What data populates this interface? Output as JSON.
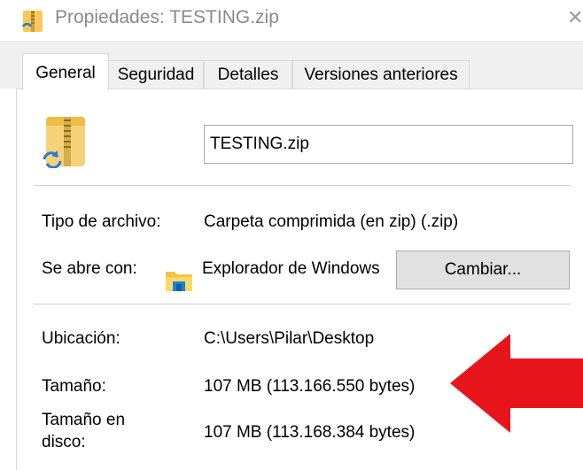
{
  "window": {
    "title": "Propiedades: TESTING.zip",
    "close_glyph": "✕",
    "icon": "zip-folder-icon"
  },
  "tabs": [
    {
      "label": "General",
      "active": true
    },
    {
      "label": "Seguridad",
      "active": false
    },
    {
      "label": "Detalles",
      "active": false
    },
    {
      "label": "Versiones anteriores",
      "active": false
    }
  ],
  "general": {
    "file_name": "TESTING.zip",
    "file_type_label": "Tipo de archivo:",
    "file_type_value": "Carpeta comprimida (en zip) (.zip)",
    "opens_with_label": "Se abre con:",
    "opens_with_value": "Explorador de Windows",
    "change_button": "Cambiar...",
    "location_label": "Ubicación:",
    "location_value": "C:\\Users\\Pilar\\Desktop",
    "size_label": "Tamaño:",
    "size_value": "107 MB (113.166.550 bytes)",
    "size_on_disk_label_line1": "Tamaño en",
    "size_on_disk_label_line2": "disco:",
    "size_on_disk_value": "107 MB (113.168.384 bytes)"
  },
  "annotation": {
    "arrow_color": "#e8141b",
    "direction": "left"
  }
}
